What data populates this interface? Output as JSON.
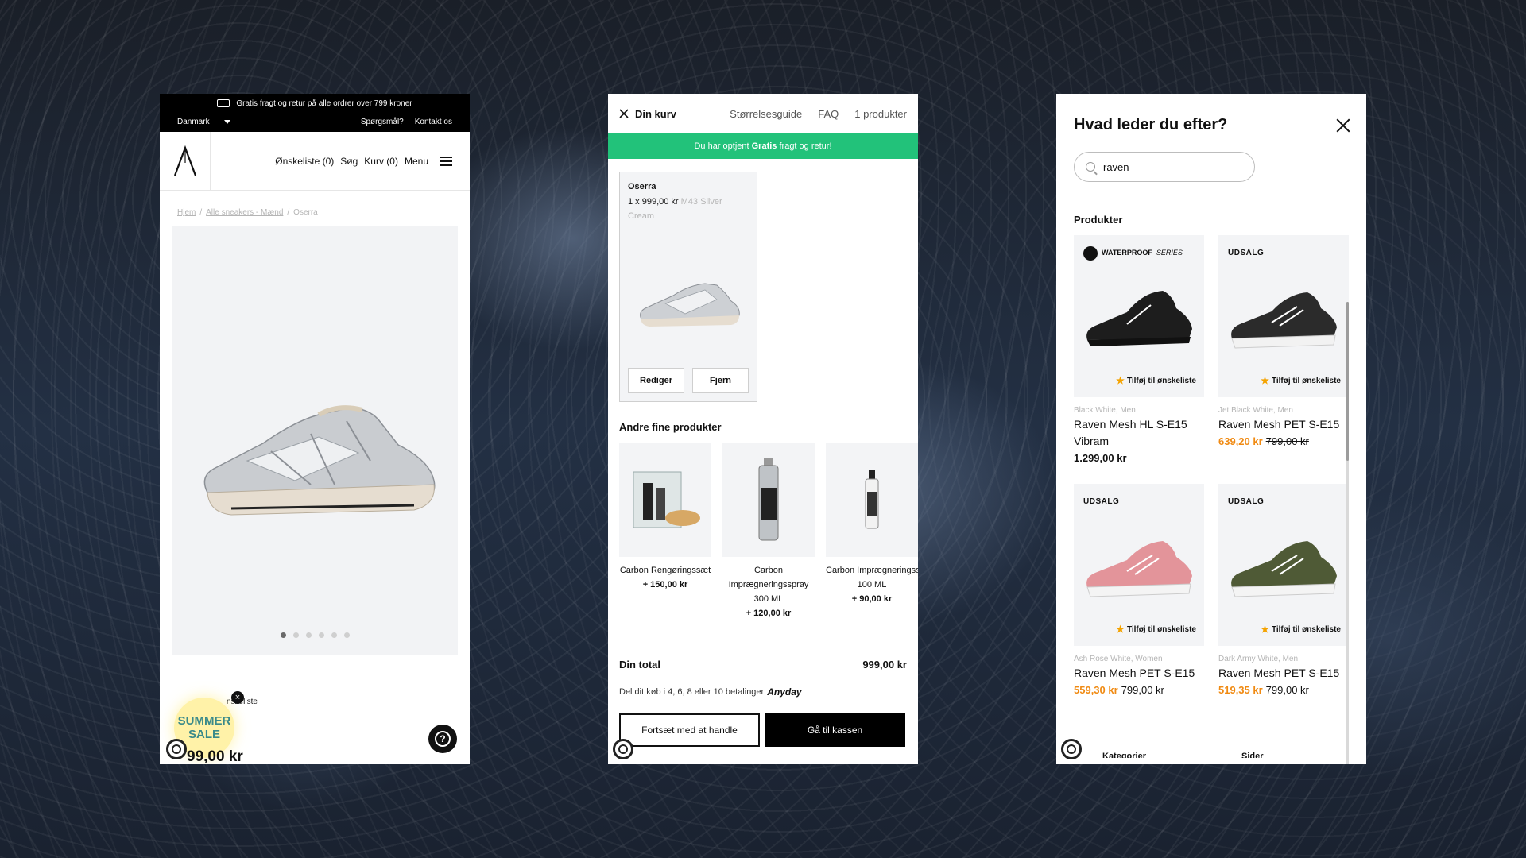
{
  "product_page": {
    "promo": "Gratis fragt og retur på alle ordrer over 799 kroner",
    "country": "Danmark",
    "top_links": [
      "Spørgsmål?",
      "Kontakt os"
    ],
    "nav": {
      "wishlist": "Ønskeliste (0)",
      "search": "Søg",
      "cart": "Kurv (0)",
      "menu": "Menu"
    },
    "breadcrumb": [
      "Hjem",
      "Alle sneakers - Mænd",
      "Oserra"
    ],
    "gallery_dots": 6,
    "wishlist_partial": "nskeliste",
    "sale_badge": [
      "SUMMER",
      "SALE"
    ],
    "badge_close": "×",
    "price_partial": "99,00 kr",
    "help": "?"
  },
  "cart": {
    "title": "Din kurv",
    "links": [
      "Størrelsesguide",
      "FAQ",
      "1 produkter"
    ],
    "banner_pre": "Du har optjent ",
    "banner_bold": "Gratis",
    "banner_post": " fragt og retur!",
    "item": {
      "name": "Oserra",
      "qty_price": "1 x 999,00 kr",
      "variant": "M43 Silver Cream",
      "edit": "Rediger",
      "remove": "Fjern"
    },
    "recommend_title": "Andre fine produkter",
    "recommendations": [
      {
        "name": "Carbon Rengøringssæt",
        "size": "",
        "price": "+ 150,00 kr"
      },
      {
        "name": "Carbon Imprægneringsspray",
        "size": "300 ML",
        "price": "+ 120,00 kr"
      },
      {
        "name": "Carbon Imprægneringssp",
        "size": "100 ML",
        "price": "+ 90,00 kr"
      }
    ],
    "total_label": "Din total",
    "total_value": "999,00 kr",
    "pay_text": "Del dit køb i 4, 6, 8 eller 10 betalinger",
    "pay_brand": "Anyday",
    "continue": "Fortsæt med at handle",
    "checkout": "Gå til kassen"
  },
  "search": {
    "title": "Hvad leder du efter?",
    "query": "raven",
    "section": "Produkter",
    "wishlist_label": "Tilføj til ønskeliste",
    "products": [
      {
        "tag": "",
        "series_main": "WATERPROOF",
        "series_sub": "SERIES",
        "sub": "Black White, Men",
        "name": "Raven Mesh HL S-E15 Vibram",
        "price": "1.299,00 kr",
        "sale": "",
        "old": ""
      },
      {
        "tag": "UDSALG",
        "series_main": "",
        "series_sub": "",
        "sub": "Jet Black White, Men",
        "name": "Raven Mesh PET S-E15",
        "price": "",
        "sale": "639,20 kr",
        "old": "799,00 kr"
      },
      {
        "tag": "UDSALG",
        "series_main": "",
        "series_sub": "",
        "sub": "Ash Rose White, Women",
        "name": "Raven Mesh PET S-E15",
        "price": "",
        "sale": "559,30 kr",
        "old": "799,00 kr"
      },
      {
        "tag": "UDSALG",
        "series_main": "",
        "series_sub": "",
        "sub": "Dark Army White, Men",
        "name": "Raven Mesh PET S-E15",
        "price": "",
        "sale": "519,35 kr",
        "old": "799,00 kr"
      }
    ],
    "tail": [
      "Kategorier",
      "Sider"
    ]
  },
  "colors": {
    "accent_green": "#22c27a",
    "sale_orange": "#f08a12",
    "shoe_black": "#1d1d1d",
    "shoe_rose": "#e3949a",
    "shoe_army": "#4f5a36"
  }
}
